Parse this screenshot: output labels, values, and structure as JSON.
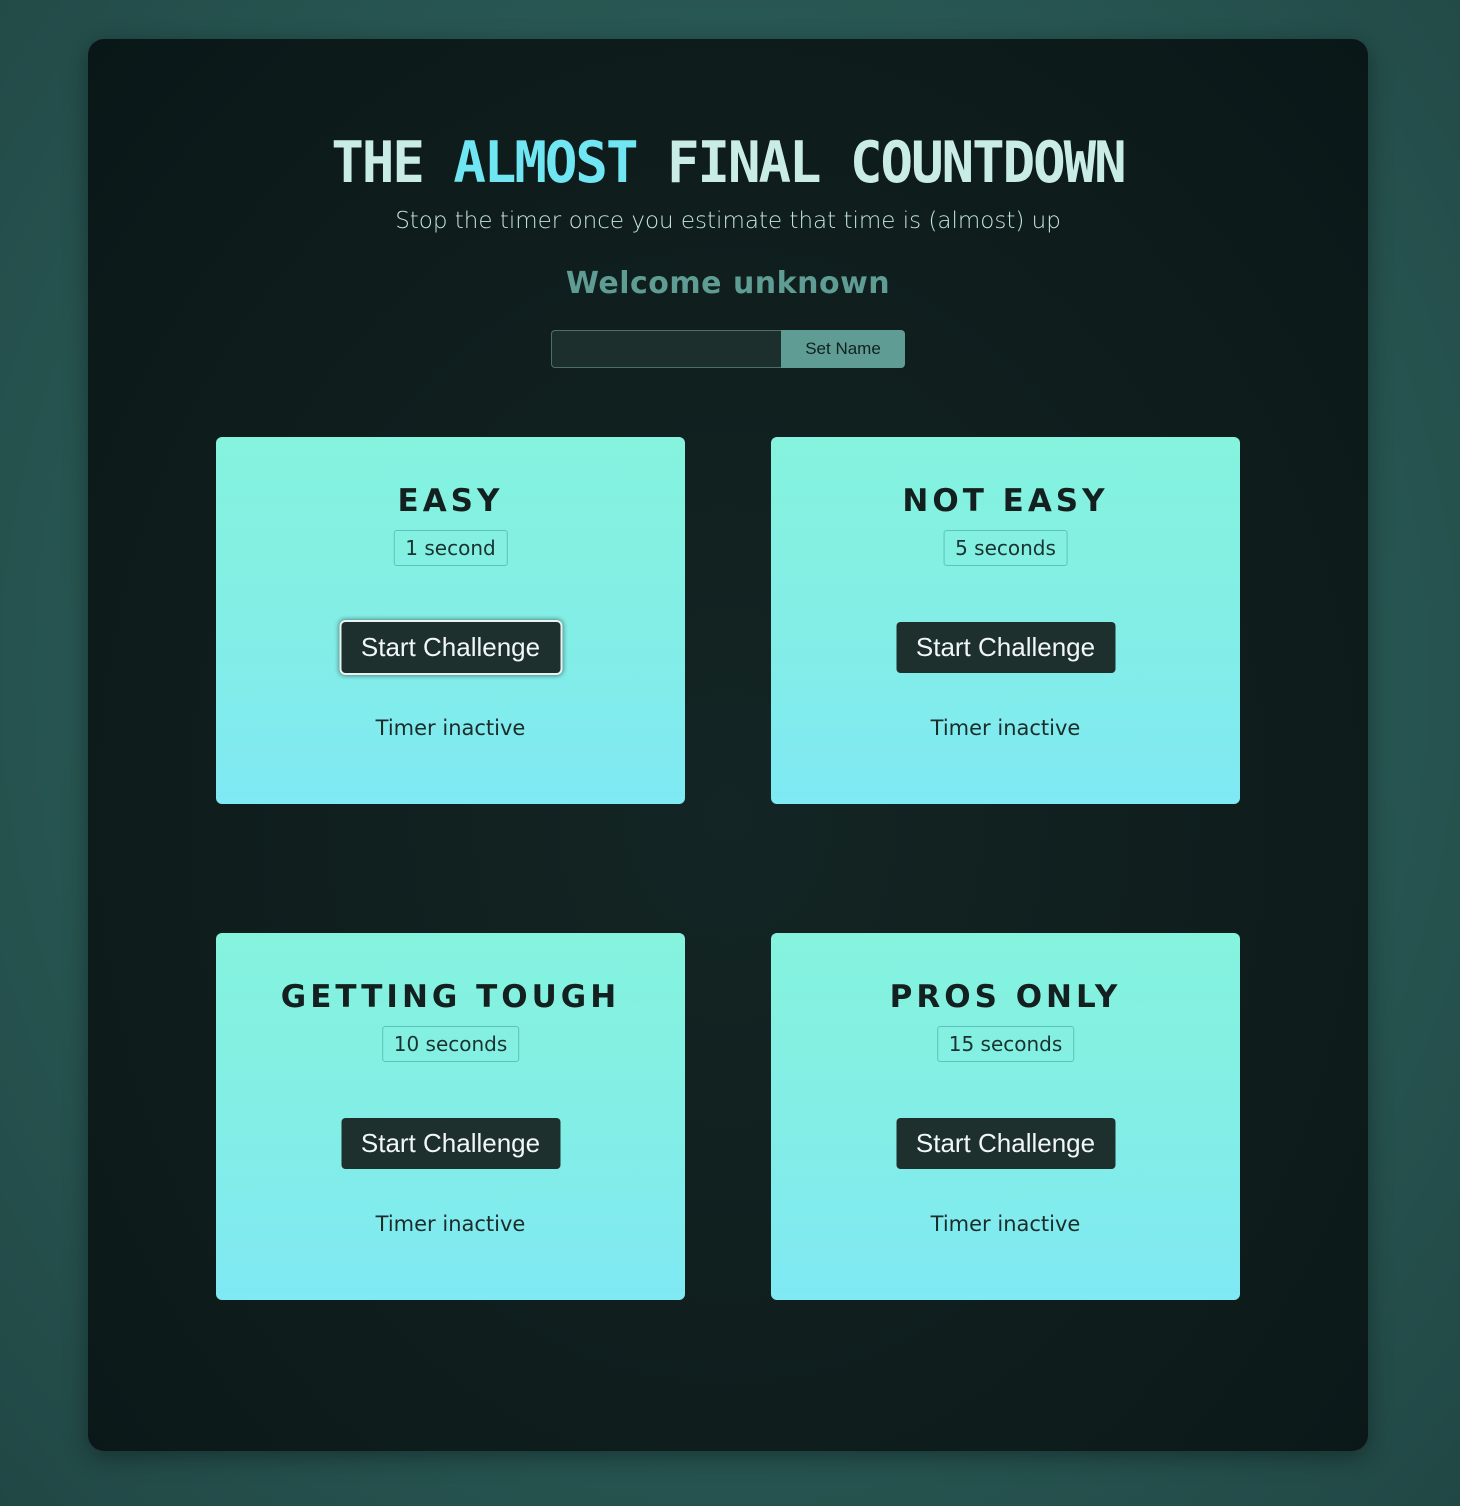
{
  "header": {
    "title_part1": "THE ",
    "title_accent": "ALMOST",
    "title_part2": " FINAL COUNTDOWN",
    "subtitle": "Stop the timer once you estimate that time is (almost) up",
    "welcome": "Welcome unknown"
  },
  "name_form": {
    "input_value": "",
    "input_placeholder": "",
    "button_label": "Set Name"
  },
  "challenges": [
    {
      "title": "EASY",
      "duration": "1 second",
      "button_label": "Start Challenge",
      "status": "Timer inactive"
    },
    {
      "title": "NOT EASY",
      "duration": "5 seconds",
      "button_label": "Start Challenge",
      "status": "Timer inactive"
    },
    {
      "title": "GETTING TOUGH",
      "duration": "10 seconds",
      "button_label": "Start Challenge",
      "status": "Timer inactive"
    },
    {
      "title": "PROS ONLY",
      "duration": "15 seconds",
      "button_label": "Start Challenge",
      "status": "Timer inactive"
    }
  ],
  "colors": {
    "page_background": "#2a5c57",
    "panel_background": "#0f1e1d",
    "title_text": "#c9ece6",
    "title_accent": "#6fe6f2",
    "welcome_text": "#5f9d94",
    "card_gradient_top": "#85f3de",
    "card_gradient_bottom": "#7fe9f4",
    "button_background": "#1d302e"
  }
}
